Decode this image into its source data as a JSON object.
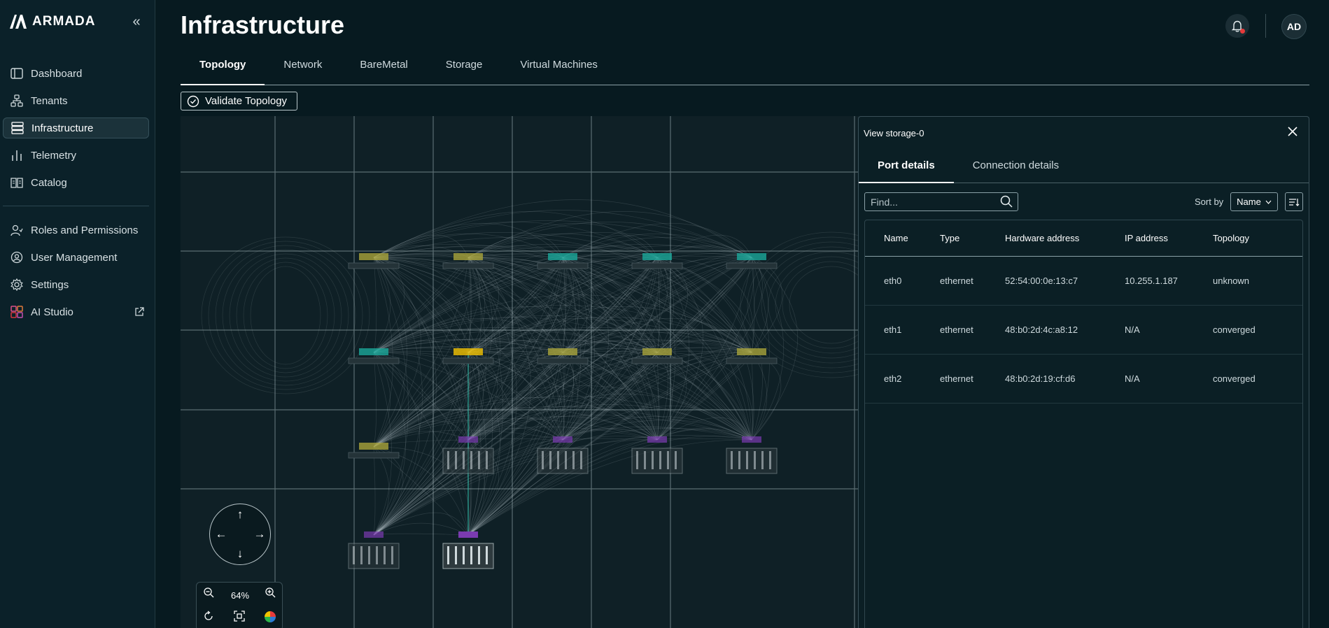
{
  "brand": {
    "name": "ARMADA"
  },
  "sidebar": {
    "items": [
      {
        "label": "Dashboard",
        "icon": "dashboard-icon"
      },
      {
        "label": "Tenants",
        "icon": "tenants-icon"
      },
      {
        "label": "Infrastructure",
        "icon": "infrastructure-icon",
        "active": true
      },
      {
        "label": "Telemetry",
        "icon": "telemetry-icon"
      },
      {
        "label": "Catalog",
        "icon": "catalog-icon"
      },
      {
        "label": "Roles and Permissions",
        "icon": "roles-icon"
      },
      {
        "label": "User Management",
        "icon": "user-management-icon"
      },
      {
        "label": "Settings",
        "icon": "gear-icon"
      },
      {
        "label": "AI Studio",
        "icon": "ai-studio-icon",
        "external": true
      }
    ]
  },
  "header": {
    "title": "Infrastructure",
    "avatar_initials": "AD"
  },
  "tabs": [
    "Topology",
    "Network",
    "BareMetal",
    "Storage",
    "Virtual Machines"
  ],
  "toolbar": {
    "validate_label": "Validate Topology"
  },
  "canvas": {
    "zoom_level": "64%"
  },
  "panel": {
    "title": "View storage-0",
    "tabs": [
      "Port details",
      "Connection details"
    ],
    "search_placeholder": "Find...",
    "sort_label": "Sort by",
    "sort_value": "Name",
    "columns": [
      "Name",
      "Type",
      "Hardware address",
      "IP address",
      "Topology"
    ],
    "rows": [
      [
        "eth0",
        "ethernet",
        "52:54:00:0e:13:c7",
        "10.255.1.187",
        "unknown"
      ],
      [
        "eth1",
        "ethernet",
        "48:b0:2d:4c:a8:12",
        "N/A",
        "converged"
      ],
      [
        "eth2",
        "ethernet",
        "48:b0:2d:19:cf:d6",
        "N/A",
        "converged"
      ]
    ]
  },
  "colors": {
    "background": "#071a20",
    "sidebar": "#0b2129",
    "node_teal": "#1aa89a",
    "node_olive": "#a8a23a",
    "node_gold": "#f2c200",
    "node_purple": "#7a3bb0",
    "notification": "#e53b3b"
  }
}
